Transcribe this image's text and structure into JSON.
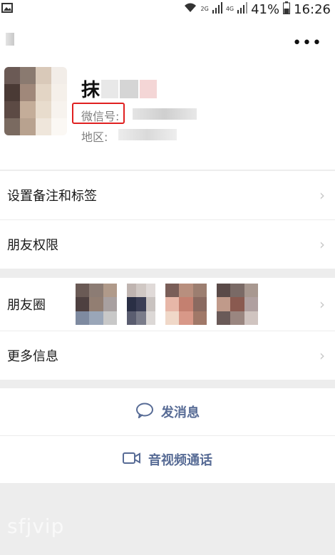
{
  "status_bar": {
    "battery": "41%",
    "time": "16:26",
    "network_small_top": "2G",
    "network_small_bottom": "4G"
  },
  "profile": {
    "name_visible": "抹",
    "wechat_id_label": "微信号:",
    "region_label": "地区:"
  },
  "menu": {
    "items": [
      {
        "label": "设置备注和标签"
      },
      {
        "label": "朋友权限"
      },
      {
        "label": "朋友圈"
      },
      {
        "label": "更多信息"
      }
    ]
  },
  "actions": {
    "send_message": "发消息",
    "av_call": "音视频通话"
  },
  "watermark": "sfjvip",
  "colors": {
    "accent_link": "#576b95",
    "highlight_box": "#e02020",
    "page_background": "#ededed"
  }
}
